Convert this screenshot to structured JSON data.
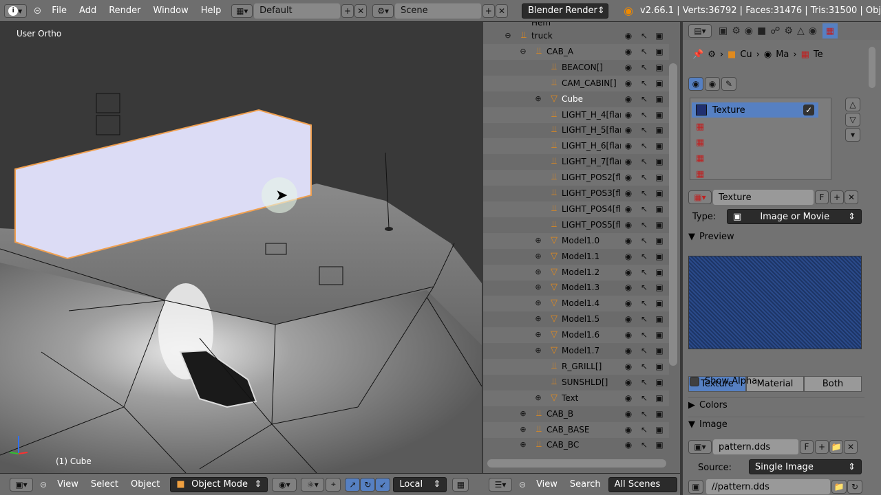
{
  "topbar": {
    "info_icon": "info-icon",
    "menus": [
      "File",
      "Add",
      "Render",
      "Window",
      "Help"
    ],
    "screen_layout": "Default",
    "scene": "Scene",
    "engine": "Blender Render",
    "stats": "v2.66.1 | Verts:36792 | Faces:31476 | Tris:31500 | Obj"
  },
  "viewport": {
    "view_label": "User Ortho",
    "object_label": "(1) Cube",
    "header": {
      "menus": [
        "View",
        "Select",
        "Object"
      ],
      "mode": "Object Mode",
      "orientation": "Local"
    }
  },
  "outliner": {
    "partial_top": "Hem",
    "rows": [
      {
        "label": "truck",
        "depth": 0,
        "type": "empty",
        "expander": "⊖"
      },
      {
        "label": "CAB_A",
        "depth": 1,
        "type": "empty",
        "expander": "⊖"
      },
      {
        "label": "BEACON[]",
        "depth": 2,
        "type": "empty",
        "expander": ""
      },
      {
        "label": "CAM_CABIN[]",
        "depth": 2,
        "type": "empty",
        "expander": ""
      },
      {
        "label": "Cube",
        "depth": 2,
        "type": "mesh",
        "expander": "⊕",
        "selected": true
      },
      {
        "label": "LIGHT_H_4[flar",
        "depth": 2,
        "type": "empty",
        "expander": ""
      },
      {
        "label": "LIGHT_H_5[flar",
        "depth": 2,
        "type": "empty",
        "expander": ""
      },
      {
        "label": "LIGHT_H_6[flar",
        "depth": 2,
        "type": "empty",
        "expander": ""
      },
      {
        "label": "LIGHT_H_7[flar",
        "depth": 2,
        "type": "empty",
        "expander": ""
      },
      {
        "label": "LIGHT_POS2[fl",
        "depth": 2,
        "type": "empty",
        "expander": ""
      },
      {
        "label": "LIGHT_POS3[fl",
        "depth": 2,
        "type": "empty",
        "expander": ""
      },
      {
        "label": "LIGHT_POS4[fl",
        "depth": 2,
        "type": "empty",
        "expander": ""
      },
      {
        "label": "LIGHT_POS5[fl",
        "depth": 2,
        "type": "empty",
        "expander": ""
      },
      {
        "label": "Model1.0",
        "depth": 2,
        "type": "mesh",
        "expander": "⊕"
      },
      {
        "label": "Model1.1",
        "depth": 2,
        "type": "mesh",
        "expander": "⊕"
      },
      {
        "label": "Model1.2",
        "depth": 2,
        "type": "mesh",
        "expander": "⊕"
      },
      {
        "label": "Model1.3",
        "depth": 2,
        "type": "mesh",
        "expander": "⊕"
      },
      {
        "label": "Model1.4",
        "depth": 2,
        "type": "mesh",
        "expander": "⊕"
      },
      {
        "label": "Model1.5",
        "depth": 2,
        "type": "mesh",
        "expander": "⊕"
      },
      {
        "label": "Model1.6",
        "depth": 2,
        "type": "mesh",
        "expander": "⊕"
      },
      {
        "label": "Model1.7",
        "depth": 2,
        "type": "mesh",
        "expander": "⊕"
      },
      {
        "label": "R_GRILL[]",
        "depth": 2,
        "type": "empty",
        "expander": ""
      },
      {
        "label": "SUNSHLD[]",
        "depth": 2,
        "type": "empty",
        "expander": ""
      },
      {
        "label": "Text",
        "depth": 2,
        "type": "mesh",
        "expander": "⊕"
      },
      {
        "label": "CAB_B",
        "depth": 1,
        "type": "empty",
        "expander": "⊕"
      },
      {
        "label": "CAB_BASE",
        "depth": 1,
        "type": "empty",
        "expander": "⊕"
      },
      {
        "label": "CAB_BC",
        "depth": 1,
        "type": "empty",
        "expander": "⊕"
      }
    ],
    "header": {
      "menus": [
        "View",
        "Search"
      ],
      "display": "All Scenes"
    }
  },
  "properties": {
    "breadcrumb": [
      "Cu",
      "Ma",
      "Te"
    ],
    "texture_slots": [
      {
        "name": "Texture",
        "active": true,
        "checked": true
      },
      {
        "name": ""
      },
      {
        "name": ""
      },
      {
        "name": ""
      },
      {
        "name": ""
      }
    ],
    "texture_name": "Texture",
    "f_label": "F",
    "type_label": "Type:",
    "type_value": "Image or Movie",
    "preview_header": "Preview",
    "preview_tabs": [
      "Texture",
      "Material",
      "Both"
    ],
    "show_alpha": "Show Alpha",
    "colors_header": "Colors",
    "image_header": "Image",
    "image_name": "pattern.dds",
    "source_label": "Source:",
    "source_value": "Single Image",
    "filepath": "//pattern.dds"
  }
}
